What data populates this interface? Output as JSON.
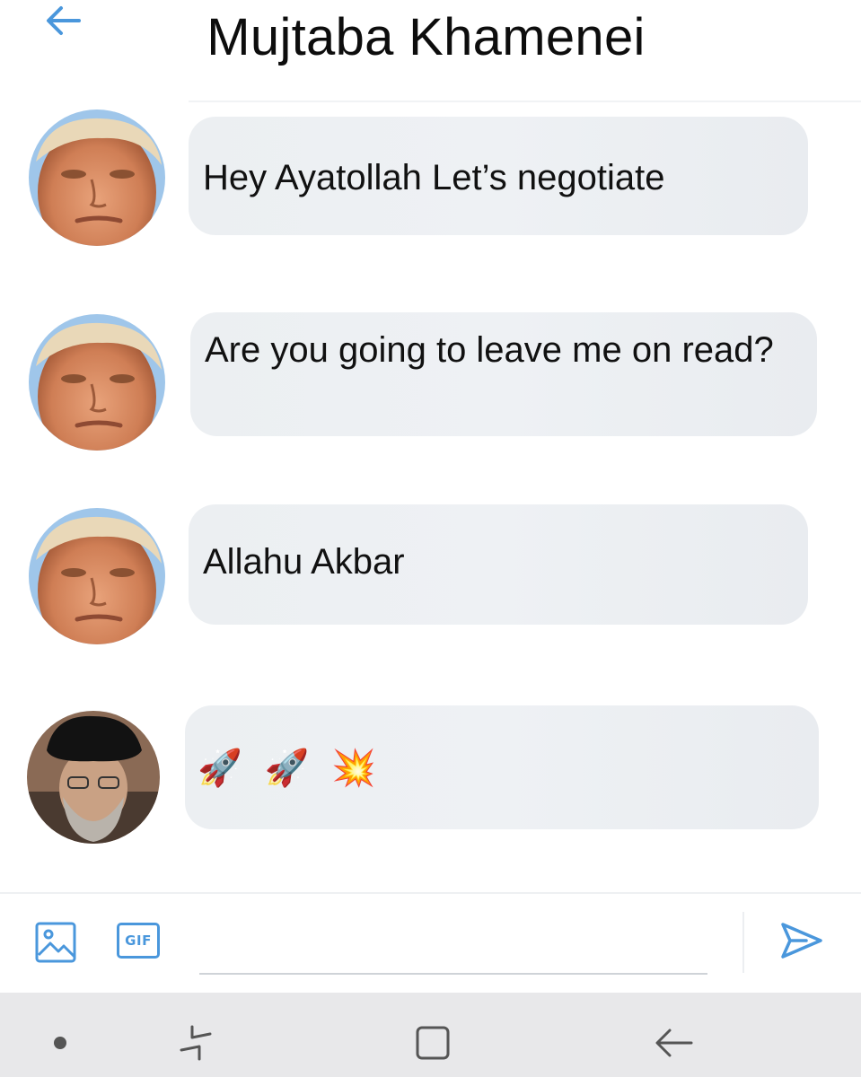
{
  "header": {
    "back_icon": "back-arrow-icon",
    "title": "Mujtaba Khamenei"
  },
  "messages": [
    {
      "sender_avatar": "avatar-orange-haired-man",
      "text": "Hey Ayatollah Let’s negotiate"
    },
    {
      "sender_avatar": "avatar-orange-haired-man",
      "text": "Are you going to leave me on read?"
    },
    {
      "sender_avatar": "avatar-orange-haired-man",
      "text": "Allahu Akbar"
    },
    {
      "sender_avatar": "avatar-cleric-black-turban",
      "text": "🚀 🚀 💥",
      "emojis": [
        "rocket",
        "rocket",
        "collision"
      ]
    }
  ],
  "composer": {
    "image_icon": "image-icon",
    "gif_label": "GIF",
    "input_value": "",
    "input_placeholder": "",
    "send_icon": "send-icon"
  },
  "navbar": {
    "items": [
      "dot-icon",
      "recents-icon",
      "home-icon",
      "back-icon"
    ]
  },
  "colors": {
    "accent": "#4a97dc",
    "bubble": "#eceff2",
    "navbar": "#e8e8ea"
  }
}
